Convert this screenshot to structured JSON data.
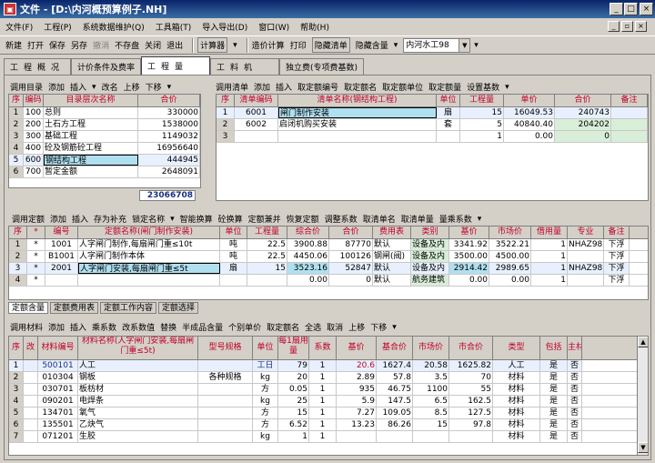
{
  "window": {
    "title": "文件 - [D:\\内河概预算例子.NH]",
    "buttons": [
      "_",
      "□",
      "×"
    ],
    "mdi_buttons": [
      "_",
      "▫",
      "×"
    ]
  },
  "menu": [
    "文件(F)",
    "工程(P)",
    "系统数据维护(Q)",
    "工具箱(T)",
    "导入导出(D)",
    "窗口(W)",
    "帮助(H)"
  ],
  "toolbar": {
    "group1": [
      "新建",
      "打开",
      "保存",
      "另存",
      "撤消",
      "不存盘",
      "关闭",
      "退出"
    ],
    "calc": "计算器",
    "group2": [
      "造价计算",
      "打印",
      "隐藏清单",
      "隐藏含量"
    ],
    "combo_value": "内河水工98"
  },
  "main_tabs": [
    "工程概况",
    "计价条件及费率",
    "工程量",
    "工料机",
    "独立费(专项费基数)"
  ],
  "tree": {
    "toolbar": [
      "调用目录",
      "添加",
      "插入",
      "改名",
      "上移",
      "下移"
    ],
    "headers": [
      "序",
      "编码",
      "目录层次名称",
      "合价"
    ],
    "rows": [
      [
        "1",
        "100",
        "总则",
        "330000"
      ],
      [
        "2",
        "200",
        "土石方工程",
        "1538000"
      ],
      [
        "3",
        "300",
        "基础工程",
        "1149032"
      ],
      [
        "4",
        "400",
        "砼及钢筋砼工程",
        "16956640"
      ],
      [
        "5",
        "600",
        "钢结构工程",
        "444945"
      ],
      [
        "6",
        "700",
        "暂定金额",
        "2648091"
      ]
    ],
    "total": "23066708"
  },
  "bills": {
    "toolbar": [
      "调用清单",
      "添加",
      "插入",
      "取定额编号",
      "取定额名",
      "取定额单位",
      "取定额量",
      "设置基数"
    ],
    "headers": [
      "序",
      "清单编码",
      "清单名称(钢结构工程)",
      "单位",
      "工程量",
      "单价",
      "合价",
      "备注"
    ],
    "rows": [
      [
        "1",
        "6001",
        "闸门制作安装",
        "扇",
        "15",
        "16049.53",
        "240743",
        ""
      ],
      [
        "2",
        "6002",
        "启闭机购买安装",
        "套",
        "5",
        "40840.40",
        "204202",
        ""
      ],
      [
        "3",
        "",
        "",
        "",
        "1",
        "0.00",
        "0",
        ""
      ]
    ]
  },
  "quota": {
    "toolbar": [
      "调用定额",
      "添加",
      "插入",
      "存为补充",
      "锁定名称",
      "智能换算",
      "砼换算",
      "定额兼并",
      "恢复定额",
      "调整系数",
      "取清单名",
      "取清单量",
      "量乘系数"
    ],
    "headers": [
      "序",
      "*",
      "编号",
      "定额名称(闸门制作安装)",
      "单位",
      "工程量",
      "综合价",
      "合价",
      "费用表",
      "类别",
      "基价",
      "市场价",
      "借用量",
      "专业",
      "备注"
    ],
    "rows": [
      [
        "1",
        "*",
        "1001",
        "人字闸门制作,每扇闸门重≤10t",
        "吨",
        "22.5",
        "3900.88",
        "87770",
        "默认",
        "设备及内",
        "3341.92",
        "3522.21",
        "1",
        "NHAZ98",
        "下浮"
      ],
      [
        "2",
        "*",
        "B1001",
        "人字闸门制作本体",
        "吨",
        "22.5",
        "4450.06",
        "100126",
        "钢闸(阀)",
        "设备及内",
        "3500.00",
        "4500.00",
        "1",
        "",
        "下浮"
      ],
      [
        "3",
        "*",
        "2001",
        "人字闸门安装,每扇闸门重≤5t",
        "扇",
        "15",
        "3523.16",
        "52847",
        "默认",
        "设备及内",
        "2914.42",
        "2989.65",
        "1",
        "NHAZ98",
        "下浮"
      ],
      [
        "4",
        "*",
        "",
        "",
        "",
        "",
        "0.00",
        "0",
        "默认",
        "航务建筑",
        "0.00",
        "0.00",
        "1",
        "",
        "下浮"
      ]
    ]
  },
  "bottom_tabs": [
    "定额含量",
    "定额费用表",
    "定额工作内容",
    "定额选择"
  ],
  "materials": {
    "toolbar": [
      "调用材料",
      "添加",
      "插入",
      "乘系数",
      "改系数值",
      "替换",
      "半成品含量",
      "个别单价",
      "取定额名",
      "全选",
      "取消",
      "上移",
      "下移"
    ],
    "headers": [
      "序",
      "改",
      "材料编号",
      "材料名称(人字闸门安装,每扇闸门重≤5t)",
      "型号规格",
      "单位",
      "每1扇用量",
      "系数",
      "基价",
      "基合价",
      "市场价",
      "市合价",
      "类型",
      "包括",
      "主材"
    ],
    "rows": [
      [
        "1",
        "",
        "500101",
        "人工",
        "",
        "工日",
        "79",
        "1",
        "20.6",
        "1627.4",
        "20.58",
        "1625.82",
        "人工",
        "是",
        "否"
      ],
      [
        "2",
        "",
        "010304",
        "钢板",
        "各种规格",
        "kg",
        "20",
        "1",
        "2.89",
        "57.8",
        "3.5",
        "70",
        "材料",
        "是",
        "否"
      ],
      [
        "3",
        "",
        "030701",
        "板枋材",
        "",
        "方",
        "0.05",
        "1",
        "935",
        "46.75",
        "1100",
        "55",
        "材料",
        "是",
        "否"
      ],
      [
        "4",
        "",
        "090201",
        "电焊条",
        "",
        "kg",
        "25",
        "1",
        "5.9",
        "147.5",
        "6.5",
        "162.5",
        "材料",
        "是",
        "否"
      ],
      [
        "5",
        "",
        "134701",
        "氧气",
        "",
        "方",
        "15",
        "1",
        "7.27",
        "109.05",
        "8.5",
        "127.5",
        "材料",
        "是",
        "否"
      ],
      [
        "6",
        "",
        "135501",
        "乙炔气",
        "",
        "方",
        "6.52",
        "1",
        "13.23",
        "86.26",
        "15",
        "97.8",
        "材料",
        "是",
        "否"
      ],
      [
        "7",
        "",
        "071201",
        "生胶",
        "",
        "kg",
        "1",
        "1",
        "",
        "",
        "",
        "",
        "材料",
        "是",
        "否"
      ]
    ]
  }
}
